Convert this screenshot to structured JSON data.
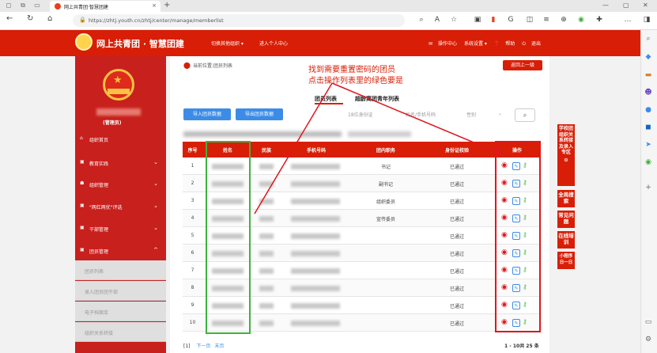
{
  "browser": {
    "tab_title": "网上共青团·智慧团建",
    "url": "https://zhtj.youth.cn/zhtj/center/manage/memberlist"
  },
  "header": {
    "site_title": "网上共青团 · 智慧团建",
    "switch_org": "切换其他组织 ▾",
    "personal_center": "进入个人中心",
    "ops_center": "操作中心",
    "system_settings": "系统设置 ▾",
    "help": "帮助",
    "logout": "退出"
  },
  "sidebar": {
    "role": "(管理员)",
    "items": [
      {
        "label": "组织首页",
        "chev": ""
      },
      {
        "label": "教育实践",
        "chev": "⌄"
      },
      {
        "label": "组织管理",
        "chev": "⌄"
      },
      {
        "label": "\"两红两优\"评选",
        "chev": "⌄"
      },
      {
        "label": "干部管理",
        "chev": "⌄"
      },
      {
        "label": "团员管理",
        "chev": "^"
      }
    ],
    "subitems": [
      "团员列表",
      "录入团员团干部",
      "电子档案库",
      "组织关系转接"
    ]
  },
  "main": {
    "breadcrumb": "当前位置:团员列表",
    "back_button": "返回上一级",
    "annotation_line1": "找到需要重置密码的团员",
    "annotation_line2": "点击操作列表里的绿色要是",
    "tab_member_list": "团员列表",
    "tab_over_age": "超龄离团青年列表",
    "import_button": "导入团员数据",
    "export_button": "导出团员数据",
    "filter_id": "18位身份证",
    "filter_name_phone": "姓名/手机号码",
    "filter_gender": "性别"
  },
  "table": {
    "headers": [
      "序号",
      "姓名",
      "民族",
      "手机号码",
      "团内职务",
      "身份证校验",
      "操作"
    ],
    "rows": [
      {
        "no": "1",
        "position": "书记",
        "verify": "已通过"
      },
      {
        "no": "2",
        "position": "副书记",
        "verify": "已通过"
      },
      {
        "no": "3",
        "position": "组织委员",
        "verify": "已通过"
      },
      {
        "no": "4",
        "position": "宣传委员",
        "verify": "已通过"
      },
      {
        "no": "5",
        "position": "",
        "verify": "已通过"
      },
      {
        "no": "6",
        "position": "",
        "verify": "已通过"
      },
      {
        "no": "7",
        "position": "",
        "verify": "已通过"
      },
      {
        "no": "8",
        "position": "",
        "verify": "已通过"
      },
      {
        "no": "9",
        "position": "",
        "verify": "已通过"
      },
      {
        "no": "10",
        "position": "",
        "verify": "已通过"
      }
    ],
    "pager_current": "[1]",
    "pager_next": "下一页",
    "pager_last": "末页",
    "total": "1 - 10共 25 条"
  },
  "quick_links": [
    "学校团组织关系转接及录入专区",
    "全局搜索",
    "常见问题",
    "在线培训",
    "小程序日一日"
  ],
  "colors": {
    "brand_red": "#d81e06",
    "blue": "#3c8ce7",
    "green_key": "#58b947"
  }
}
